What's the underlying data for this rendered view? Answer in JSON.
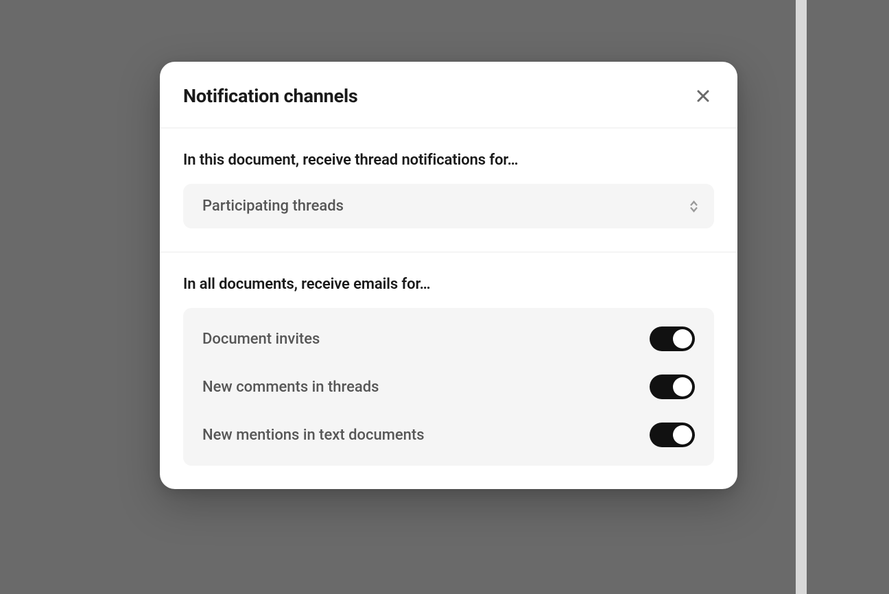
{
  "modal": {
    "title": "Notification channels",
    "section1": {
      "label": "In this document, receive thread notifications for…",
      "selected": "Participating threads"
    },
    "section2": {
      "label": "In all documents, receive emails for…",
      "toggles": [
        {
          "label": "Document invites",
          "on": true
        },
        {
          "label": "New comments in threads",
          "on": true
        },
        {
          "label": "New mentions in text documents",
          "on": true
        }
      ]
    }
  }
}
